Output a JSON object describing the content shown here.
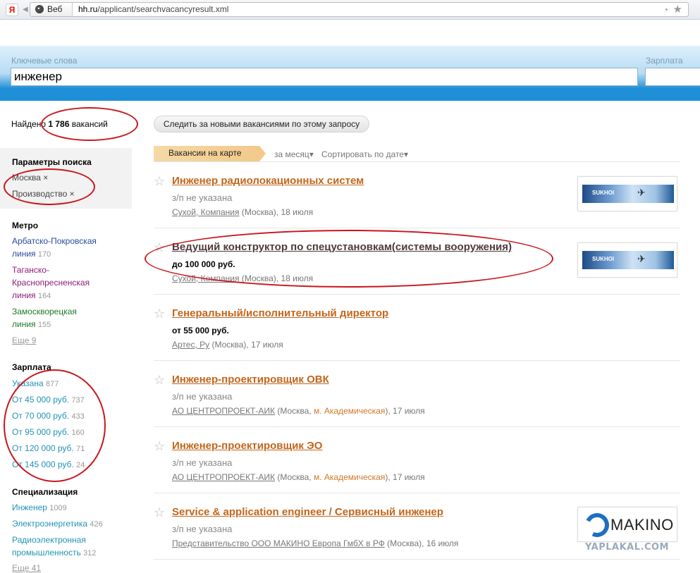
{
  "browser": {
    "logo": "Я",
    "web_label": "Веб",
    "url_domain": "hh.ru",
    "url_path": "/applicant/searchvacancyresult.xml"
  },
  "search": {
    "keywords_label": "Ключевые слова",
    "keywords_value": "инженер",
    "salary_label": "Зарплата",
    "salary_value": ""
  },
  "results": {
    "found_prefix": "Найдено",
    "found_count": "1 786",
    "found_suffix": "вакансий",
    "follow_button": "Следить за новыми вакансиями по этому запросу"
  },
  "sidebar": {
    "params_title": "Параметры поиска",
    "filters": [
      "Москва ×",
      "Производство ×"
    ],
    "metro_title": "Метро",
    "metro": [
      {
        "line1": "Арбатско-Покровская",
        "line2": "линия",
        "count": "170"
      },
      {
        "line1": "Таганско-",
        "line1b": "Краснопресненская",
        "line2": "линия",
        "count": "164"
      },
      {
        "line1": "Замоскворецкая",
        "line2": "линия",
        "count": "155"
      }
    ],
    "metro_more": "Еще 9",
    "salary_title": "Зарплата",
    "salary": [
      {
        "label": "Указана",
        "count": "877"
      },
      {
        "label": "От 45 000 руб.",
        "count": "737"
      },
      {
        "label": "От 70 000 руб.",
        "count": "433"
      },
      {
        "label": "От 95 000 руб.",
        "count": "160"
      },
      {
        "label": "От 120 000 руб.",
        "count": "71"
      },
      {
        "label": "От 145 000 руб.",
        "count": "24"
      }
    ],
    "spec_title": "Специализация",
    "spec": [
      {
        "label": "Инженер",
        "count": "1009"
      },
      {
        "label": "Электроэнергетика",
        "count": "426"
      },
      {
        "label1": "Радиоэлектронная",
        "label2": "промышленность",
        "count": "312"
      }
    ],
    "spec_more": "Еще 41"
  },
  "toolbar": {
    "map_tab": "Вакансии на карте",
    "period": "за месяц",
    "sort": "Сортировать по дате"
  },
  "vacancies": [
    {
      "title": "Инженер радиолокационных систем",
      "salary": "з/п не указана",
      "company": "Сухой, Компания",
      "location": "(Москва),",
      "date": "18 июля",
      "logo": "SUKHOI"
    },
    {
      "title": "Ведущий конструктор по спецустановкам(системы вооружения)",
      "salary": "до 100 000 руб.",
      "company": "Сухой, Компания",
      "location": "(Москва),",
      "date": "18 июля",
      "logo": "SUKHOI"
    },
    {
      "title": "Генеральный/исполнительный директор",
      "salary": "от 55 000 руб.",
      "company": "Артес, Ру",
      "location": "(Москва),",
      "date": "17 июля"
    },
    {
      "title": "Инженер-проектировщик ОВК",
      "salary": "з/п не указана",
      "company": "АО ЦЕНТРОПРОЕКТ-АИК",
      "location": "(Москва,",
      "metro": "м. Академическая",
      "after_metro": "),",
      "date": "17 июля"
    },
    {
      "title": "Инженер-проектировщик ЭО",
      "salary": "з/п не указана",
      "company": "АО ЦЕНТРОПРОЕКТ-АИК",
      "location": "(Москва,",
      "metro": "м. Академическая",
      "after_metro": "),",
      "date": "17 июля"
    },
    {
      "title": "Service & application engineer / Сервисный инженер",
      "salary": "з/п не указана",
      "company": "Представительство ООО МАКИНО Европа ГмбХ в РФ",
      "location": "(Москва),",
      "date": "16 июля",
      "logo": "MAKINO"
    }
  ],
  "watermark": "YAPLAKAL.COM",
  "colors": {
    "link_orange": "#c2661b",
    "annotation_red": "#c8161d",
    "header_blue": "#1e8ed6"
  }
}
